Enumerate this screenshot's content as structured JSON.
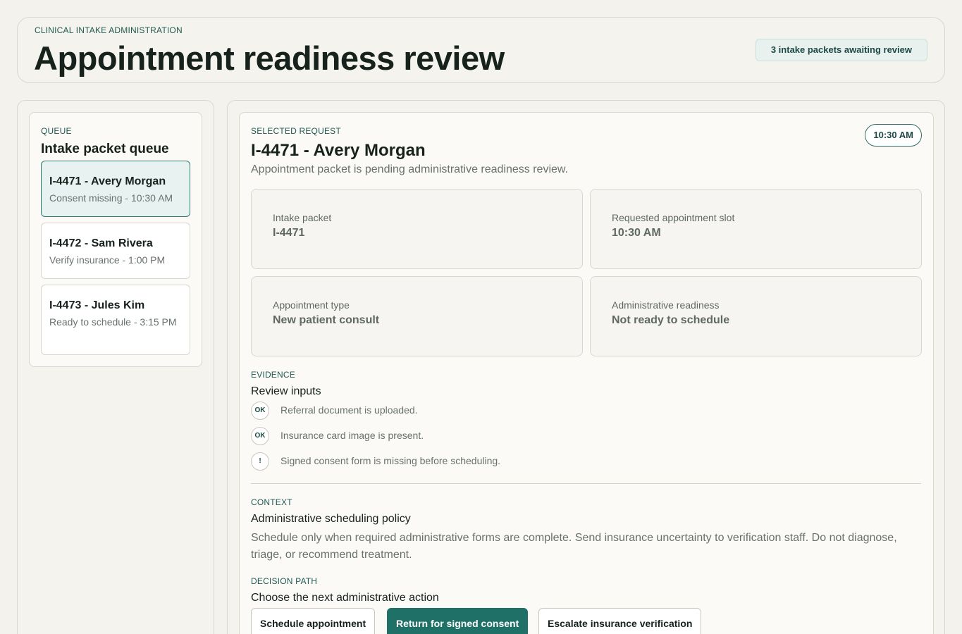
{
  "header": {
    "eyebrow": "CLINICAL INTAKE ADMINISTRATION",
    "title": "Appointment readiness review",
    "badge": "3 intake packets awaiting review"
  },
  "queue": {
    "eyebrow": "QUEUE",
    "title": "Intake packet queue",
    "items": [
      {
        "title": "I-4471 - Avery Morgan",
        "subtitle": "Consent missing - 10:30 AM"
      },
      {
        "title": "I-4472 - Sam Rivera",
        "subtitle": "Verify insurance - 1:00 PM"
      },
      {
        "title": "I-4473 - Jules Kim",
        "subtitle": "Ready to schedule - 3:15 PM"
      }
    ]
  },
  "selected": {
    "eyebrow": "SELECTED REQUEST",
    "title": "I-4471 - Avery Morgan",
    "subtitle": "Appointment packet is pending administrative readiness review.",
    "time": "10:30 AM",
    "fields": [
      {
        "label": "Intake packet",
        "value": "I-4471"
      },
      {
        "label": "Requested appointment slot",
        "value": "10:30 AM"
      },
      {
        "label": "Appointment type",
        "value": "New patient consult"
      },
      {
        "label": "Administrative readiness",
        "value": "Not ready to schedule"
      }
    ]
  },
  "evidence": {
    "eyebrow": "EVIDENCE",
    "title": "Review inputs",
    "items": [
      {
        "icon": "OK",
        "text": "Referral document is uploaded."
      },
      {
        "icon": "OK",
        "text": "Insurance card image is present."
      },
      {
        "icon": "!",
        "text": "Signed consent form is missing before scheduling."
      }
    ]
  },
  "context": {
    "eyebrow": "CONTEXT",
    "title": "Administrative scheduling policy",
    "text": "Schedule only when required administrative forms are complete. Send insurance uncertainty to verification staff. Do not diagnose, triage, or recommend treatment."
  },
  "decision": {
    "eyebrow": "DECISION PATH",
    "title": "Choose the next administrative action",
    "actions": [
      {
        "label": "Schedule appointment"
      },
      {
        "label": "Return for signed consent"
      },
      {
        "label": "Escalate insurance verification"
      }
    ]
  },
  "colors": {
    "accent": "#1f7167",
    "background": "#f3f2ed",
    "active_item_bg": "#e8f3f1"
  }
}
